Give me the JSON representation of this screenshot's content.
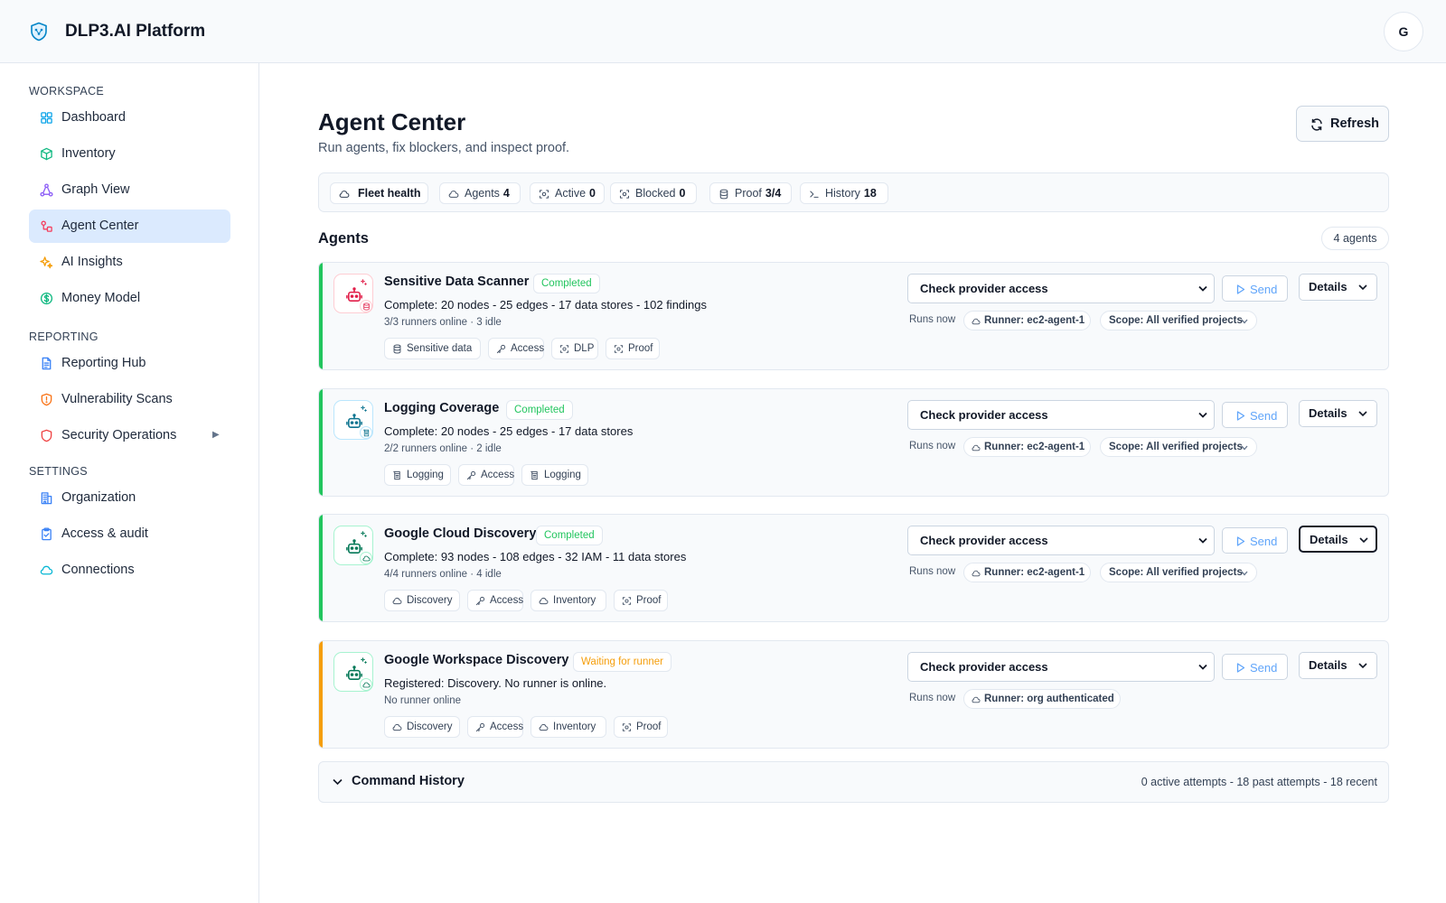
{
  "app": {
    "title": "DLP3.AI Platform",
    "avatar_initial": "G"
  },
  "sidebar": {
    "sections": [
      {
        "label": "WORKSPACE",
        "items": [
          {
            "label": "Dashboard",
            "icon": "dashboard-icon",
            "color": "#0ea5e9"
          },
          {
            "label": "Inventory",
            "icon": "cube-icon",
            "color": "#10b981"
          },
          {
            "label": "Graph View",
            "icon": "graph-icon",
            "color": "#8b5cf6"
          },
          {
            "label": "Agent Center",
            "icon": "agent-icon",
            "color": "#f43f5e",
            "active": true
          },
          {
            "label": "AI Insights",
            "icon": "sparkle-icon",
            "color": "#f59e0b"
          },
          {
            "label": "Money Model",
            "icon": "dollar-icon",
            "color": "#10b981"
          }
        ]
      },
      {
        "label": "REPORTING",
        "items": [
          {
            "label": "Reporting Hub",
            "icon": "document-icon",
            "color": "#3b82f6"
          },
          {
            "label": "Vulnerability Scans",
            "icon": "shield-alert-icon",
            "color": "#f97316"
          },
          {
            "label": "Security Operations",
            "icon": "shield-icon",
            "color": "#ef4444",
            "has_caret": true
          }
        ]
      },
      {
        "label": "SETTINGS",
        "items": [
          {
            "label": "Organization",
            "icon": "building-icon",
            "color": "#3b82f6"
          },
          {
            "label": "Access & audit",
            "icon": "clipboard-icon",
            "color": "#3b82f6"
          },
          {
            "label": "Connections",
            "icon": "cloud-icon",
            "color": "#06b6d4"
          }
        ]
      }
    ],
    "caret_glyph": "▶"
  },
  "page": {
    "title": "Agent Center",
    "subtitle": "Run agents, fix blockers, and inspect proof.",
    "refresh_label": "Refresh"
  },
  "fleet": {
    "label": "Fleet health",
    "chips": [
      {
        "label": "Agents",
        "value": "4",
        "icon": "cloud-icon"
      },
      {
        "label": "Active",
        "value": "0",
        "icon": "scan-icon"
      },
      {
        "label": "Blocked",
        "value": "0",
        "icon": "scan-icon"
      },
      {
        "label": "Proof",
        "value": "3/4",
        "icon": "database-icon"
      },
      {
        "label": "History",
        "value": "18",
        "icon": "terminal-icon"
      }
    ]
  },
  "agents_section": {
    "title": "Agents",
    "count": "4 agents"
  },
  "agents": [
    {
      "name": "Sensitive Data Scanner",
      "status": "Completed",
      "status_color": "#22c55e",
      "accent": "#22c55e",
      "icon_color": "#e11d48",
      "icon_border": "#fecdd3",
      "badge_icon": "database-icon",
      "description": "Complete: 20 nodes - 25 edges - 17 data stores - 102 findings",
      "runners": "3/3 runners online · 3 idle",
      "tags": [
        {
          "label": "Sensitive data",
          "icon": "database-icon"
        },
        {
          "label": "Access",
          "icon": "key-icon"
        },
        {
          "label": "DLP",
          "icon": "scan-icon"
        },
        {
          "label": "Proof",
          "icon": "scan-icon"
        }
      ],
      "command": "Check provider access",
      "send_label": "Send",
      "details_label": "Details",
      "runs_now": "Runs now",
      "runner": "Runner: ec2-agent-1",
      "scope": "Scope: All verified projects"
    },
    {
      "name": "Logging Coverage",
      "status": "Completed",
      "status_color": "#22c55e",
      "accent": "#22c55e",
      "icon_color": "#0e7490",
      "icon_border": "#bae6fd",
      "badge_icon": "log-icon",
      "description": "Complete: 20 nodes - 25 edges - 17 data stores",
      "runners": "2/2 runners online · 2 idle",
      "tags": [
        {
          "label": "Logging",
          "icon": "log-icon"
        },
        {
          "label": "Access",
          "icon": "key-icon"
        },
        {
          "label": "Logging",
          "icon": "log-icon"
        }
      ],
      "command": "Check provider access",
      "send_label": "Send",
      "details_label": "Details",
      "runs_now": "Runs now",
      "runner": "Runner: ec2-agent-1",
      "scope": "Scope: All verified projects"
    },
    {
      "name": "Google Cloud Discovery",
      "status": "Completed",
      "status_color": "#22c55e",
      "accent": "#22c55e",
      "icon_color": "#047857",
      "icon_border": "#a7f3d0",
      "badge_icon": "cloud-icon",
      "description": "Complete: 93 nodes - 108 edges - 32 IAM - 11 data stores",
      "runners": "4/4 runners online · 4 idle",
      "tags": [
        {
          "label": "Discovery",
          "icon": "cloud-icon"
        },
        {
          "label": "Access",
          "icon": "key-icon"
        },
        {
          "label": "Inventory",
          "icon": "cloud-icon"
        },
        {
          "label": "Proof",
          "icon": "scan-icon"
        }
      ],
      "command": "Check provider access",
      "send_label": "Send",
      "details_label": "Details",
      "details_focused": true,
      "runs_now": "Runs now",
      "runner": "Runner: ec2-agent-1",
      "scope": "Scope: All verified projects"
    },
    {
      "name": "Google Workspace Discovery",
      "status": "Waiting for runner",
      "status_color": "#f59e0b",
      "accent": "#f59e0b",
      "icon_color": "#047857",
      "icon_border": "#a7f3d0",
      "badge_icon": "cloud-icon",
      "description": "Registered: Discovery. No runner is online.",
      "runners": "No runner online",
      "tags": [
        {
          "label": "Discovery",
          "icon": "cloud-icon"
        },
        {
          "label": "Access",
          "icon": "key-icon"
        },
        {
          "label": "Inventory",
          "icon": "cloud-icon"
        },
        {
          "label": "Proof",
          "icon": "scan-icon"
        }
      ],
      "command": "Check provider access",
      "send_label": "Send",
      "details_label": "Details",
      "runs_now": "Runs now",
      "runner": "Runner: org authenticated",
      "scope": ""
    }
  ],
  "history": {
    "title": "Command History",
    "summary": "0 active attempts - 18 past attempts - 18 recent"
  }
}
